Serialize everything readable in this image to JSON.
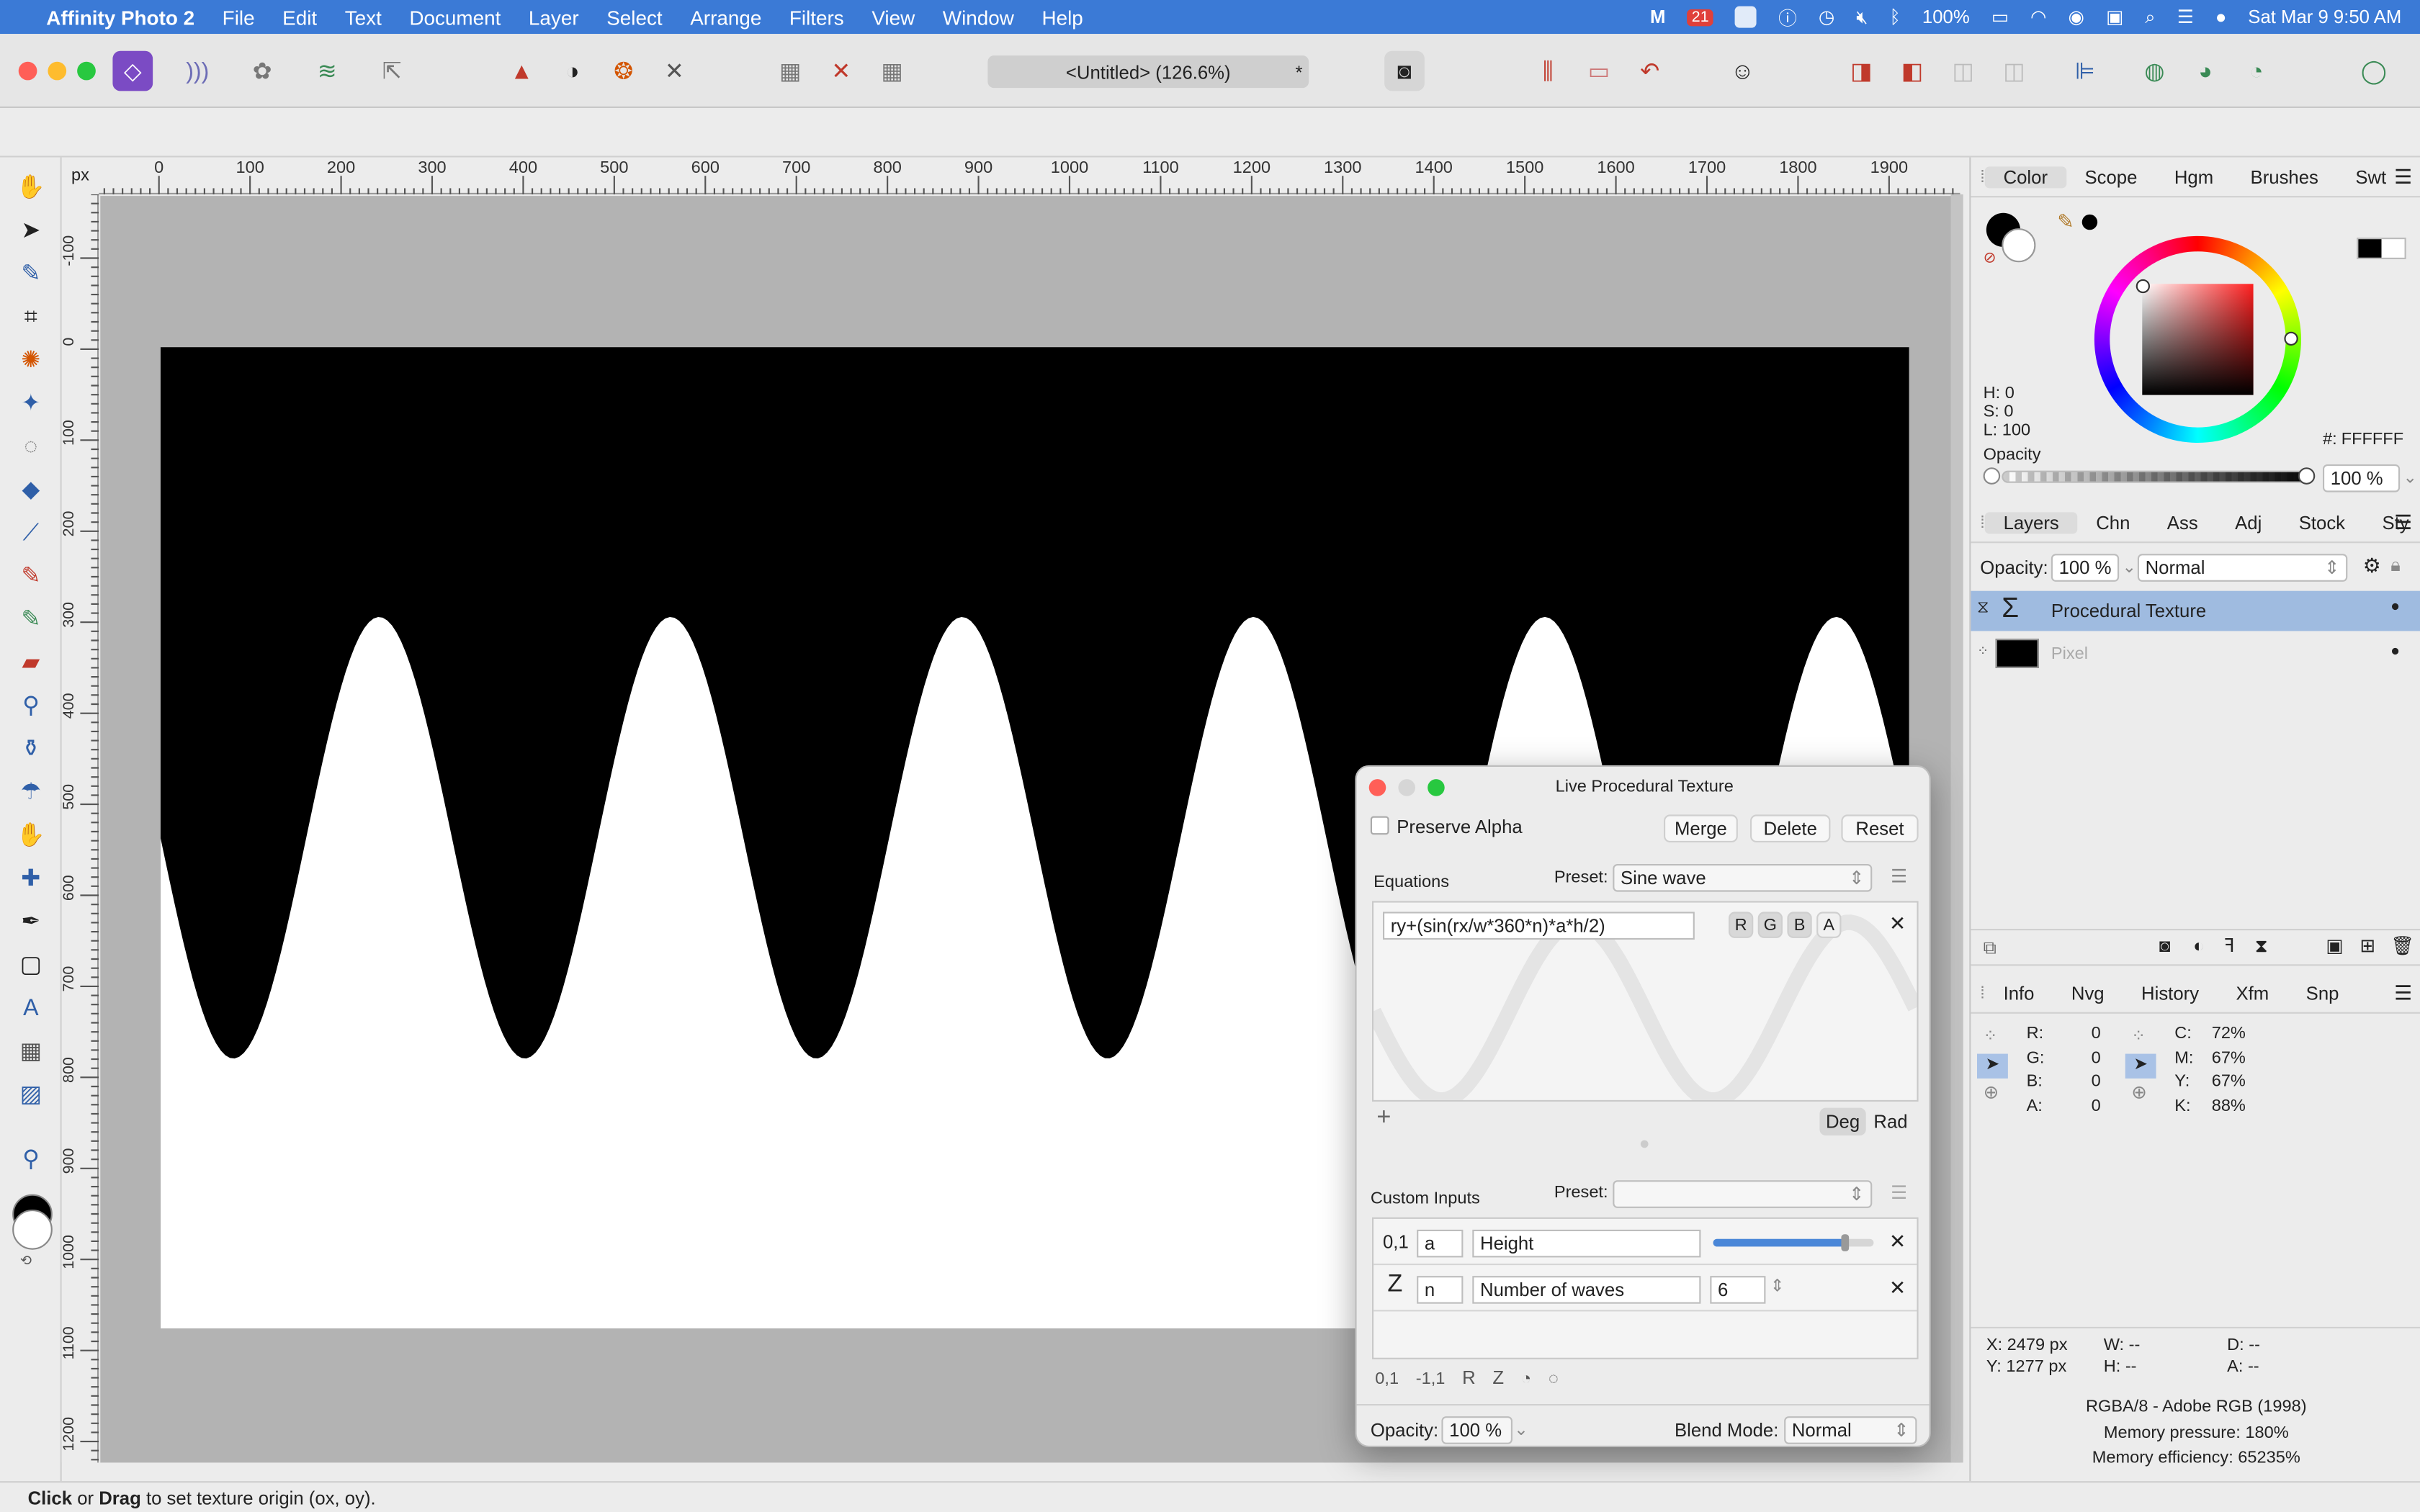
{
  "menubar": {
    "app": "Affinity Photo 2",
    "items": [
      "File",
      "Edit",
      "Text",
      "Document",
      "Layer",
      "Select",
      "Arrange",
      "Filters",
      "View",
      "Window",
      "Help"
    ],
    "calendar_badge": "21",
    "battery": "100%",
    "datetime": "Sat Mar 9  9:50 AM"
  },
  "toolbar": {
    "document_title": "<Untitled> (126.6%)",
    "modified_mark": "*"
  },
  "rulers": {
    "unit": "px",
    "h_labels": [
      "0",
      "100",
      "200",
      "300",
      "400",
      "500",
      "600",
      "700",
      "800",
      "900",
      "1000",
      "1100",
      "1200",
      "1300",
      "1400",
      "1500",
      "1600",
      "1700",
      "1800",
      "1900"
    ],
    "v_labels": [
      "-100",
      "0",
      "100",
      "200",
      "300",
      "400",
      "500",
      "600",
      "700",
      "800",
      "900",
      "1000",
      "1100",
      "1200"
    ]
  },
  "texture": {
    "waves": 6,
    "amplitude_fraction": 0.45,
    "fill_top": "#000000",
    "fill_bottom": "#ffffff"
  },
  "color_panel": {
    "tabs": [
      "Color",
      "Scope",
      "Hgm",
      "Brushes",
      "Swt"
    ],
    "h": "H: 0",
    "s": "S: 0",
    "l": "L: 100",
    "hex_label": "#:",
    "hex_value": "FFFFFF",
    "opacity_label": "Opacity",
    "opacity_value": "100 %"
  },
  "layers_panel": {
    "tabs": [
      "Layers",
      "Chn",
      "Ass",
      "Adj",
      "Stock",
      "Sty"
    ],
    "opacity_label": "Opacity:",
    "opacity_value": "100 %",
    "blend_mode": "Normal",
    "layers": [
      {
        "name": "Procedural Texture"
      },
      {
        "name": "Pixel"
      }
    ]
  },
  "info_panel": {
    "tabs": [
      "Info",
      "Nvg",
      "History",
      "Xfm",
      "Snp"
    ],
    "rgba": [
      {
        "label": "R:",
        "value": "0"
      },
      {
        "label": "G:",
        "value": "0"
      },
      {
        "label": "B:",
        "value": "0"
      },
      {
        "label": "A:",
        "value": "0"
      }
    ],
    "cmyk": [
      {
        "label": "C:",
        "value": "72%"
      },
      {
        "label": "M:",
        "value": "67%"
      },
      {
        "label": "Y:",
        "value": "67%"
      },
      {
        "label": "K:",
        "value": "88%"
      }
    ],
    "x": "X: 2479 px",
    "y": "Y: 1277 px",
    "w": "W: --",
    "h": "H: --",
    "d": "D: --",
    "a": "A: --",
    "color_profile": "RGBA/8 - Adobe RGB (1998)",
    "memory_pressure": "Memory pressure: 180%",
    "memory_efficiency": "Memory efficiency: 65235%"
  },
  "dialog": {
    "title": "Live Procedural Texture",
    "preserve_alpha": "Preserve Alpha",
    "merge": "Merge",
    "delete": "Delete",
    "reset": "Reset",
    "equations_label": "Equations",
    "preset_label": "Preset:",
    "preset_value": "Sine wave",
    "equation": "ry+(sin(rx/w*360*n)*a*h/2)",
    "channels": [
      "R",
      "G",
      "B",
      "A"
    ],
    "add": "+",
    "deg": "Deg",
    "rad": "Rad",
    "custom_inputs_label": "Custom Inputs",
    "custom_preset_label": "Preset:",
    "inputs": [
      {
        "type": "0,1",
        "var": "a",
        "name": "Height",
        "slider": 0.82
      },
      {
        "type": "Z",
        "var": "n",
        "name": "Number of waves",
        "value": "6"
      }
    ],
    "input_types": [
      "0,1",
      "-1,1",
      "R",
      "Z"
    ],
    "opacity_label": "Opacity:",
    "opacity_value": "100 %",
    "blend_label": "Blend Mode:",
    "blend_value": "Normal"
  },
  "status": {
    "click": "Click",
    "or": " or ",
    "drag": "Drag",
    "rest": " to set texture origin (ox, oy)."
  }
}
